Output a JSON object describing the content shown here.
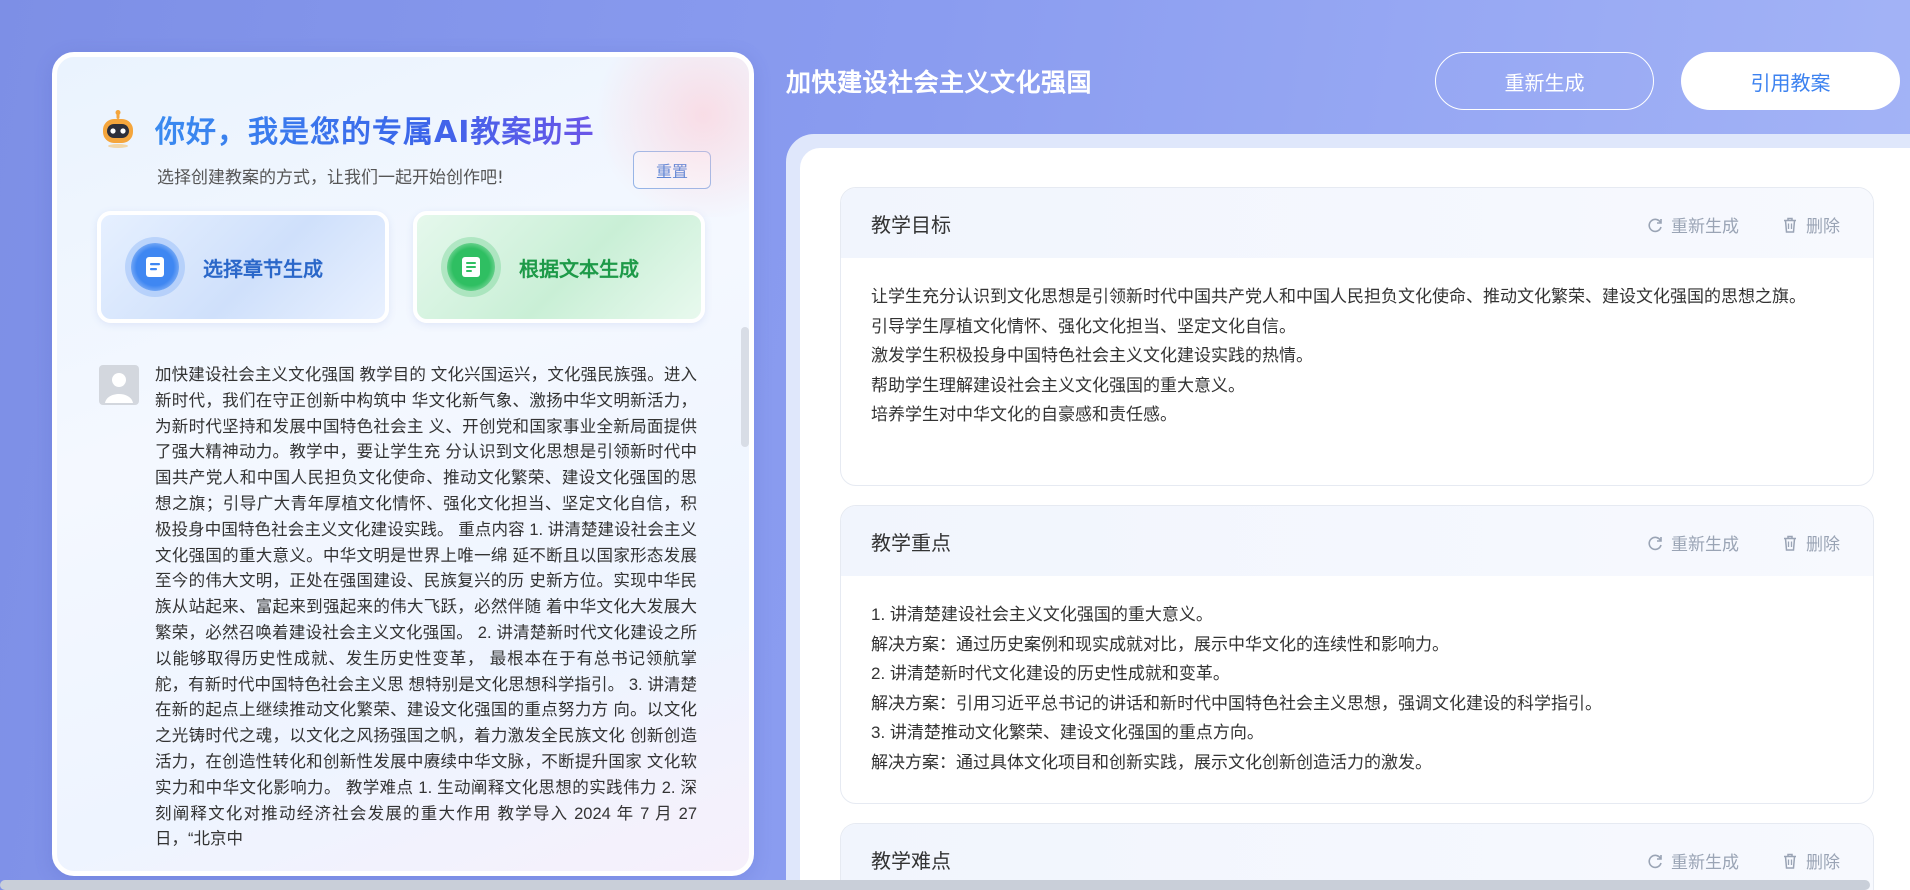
{
  "assistant": {
    "greeting": "你好，我是您的专属AI教案助手",
    "subtitle": "选择创建教案的方式，让我们一起开始创作吧!",
    "reset_label": "重置",
    "modes": [
      {
        "label": "选择章节生成",
        "icon": "document-icon",
        "color": "#3f87f2"
      },
      {
        "label": "根据文本生成",
        "icon": "text-note-icon",
        "color": "#2fbf62"
      }
    ],
    "user_message": "加快建设社会主义文化强国 教学目的 文化兴国运兴，文化强民族强。进入新时代，我们在守正创新中构筑中 华文化新气象、激扬中华文明新活力，为新时代坚持和发展中国特色社会主 义、开创党和国家事业全新局面提供了强大精神动力。教学中，要让学生充 分认识到文化思想是引领新时代中国共产党人和中国人民担负文化使命、推动文化繁荣、建设文化强国的思想之旗；引导广大青年厚植文化情怀、强化文化担当、坚定文化自信，积极投身中国特色社会主义文化建设实践。 重点内容 1. 讲清楚建设社会主义文化强国的重大意义。中华文明是世界上唯一绵 延不断且以国家形态发展至今的伟大文明，正处在强国建设、民族复兴的历 史新方位。实现中华民族从站起来、富起来到强起来的伟大飞跃，必然伴随 着中华文化大发展大繁荣，必然召唤着建设社会主义文化强国。 2. 讲清楚新时代文化建设之所以能够取得历史性成就、发生历史性变革， 最根本在于有总书记领航掌舵，有新时代中国特色社会主义思 想特别是文化思想科学指引。 3. 讲清楚在新的起点上继续推动文化繁荣、建设文化强国的重点努力方 向。以文化之光铸时代之魂，以文化之风扬强国之帆，着力激发全民族文化 创新创造活力，在创造性转化和创新性发展中赓续中华文脉，不断提升国家 文化软实力和中华文化影响力。 教学难点 1. 生动阐释文化思想的实践伟力 2. 深刻阐释文化对推动经济社会发展的重大作用 教学导入 2024 年 7 月 27 日，“北京中"
  },
  "document": {
    "title": "加快建设社会主义文化强国",
    "regenerate_label": "重新生成",
    "quote_label": "引用教案"
  },
  "sections": [
    {
      "title": "教学目标",
      "regen_label": "重新生成",
      "delete_label": "删除",
      "lines": [
        "让学生充分认识到文化思想是引领新时代中国共产党人和中国人民担负文化使命、推动文化繁荣、建设文化强国的思想之旗。",
        "引导学生厚植文化情怀、强化文化担当、坚定文化自信。",
        "激发学生积极投身中国特色社会主义文化建设实践的热情。",
        "帮助学生理解建设社会主义文化强国的重大意义。",
        "培养学生对中华文化的自豪感和责任感。"
      ]
    },
    {
      "title": "教学重点",
      "regen_label": "重新生成",
      "delete_label": "删除",
      "lines": [
        "1. 讲清楚建设社会主义文化强国的重大意义。",
        "解决方案：通过历史案例和现实成就对比，展示中华文化的连续性和影响力。",
        "2. 讲清楚新时代文化建设的历史性成就和变革。",
        "解决方案：引用习近平总书记的讲话和新时代中国特色社会主义思想，强调文化建设的科学指引。",
        "3. 讲清楚推动文化繁荣、建设文化强国的重点方向。",
        "解决方案：通过具体文化项目和创新实践，展示文化创新创造活力的激发。"
      ]
    },
    {
      "title": "教学难点",
      "regen_label": "重新生成",
      "delete_label": "删除",
      "lines": []
    }
  ],
  "icons": {
    "assistant": "robot-icon",
    "section_regen": "refresh-icon",
    "section_delete": "trash-icon",
    "avatar": "user-avatar-icon"
  }
}
